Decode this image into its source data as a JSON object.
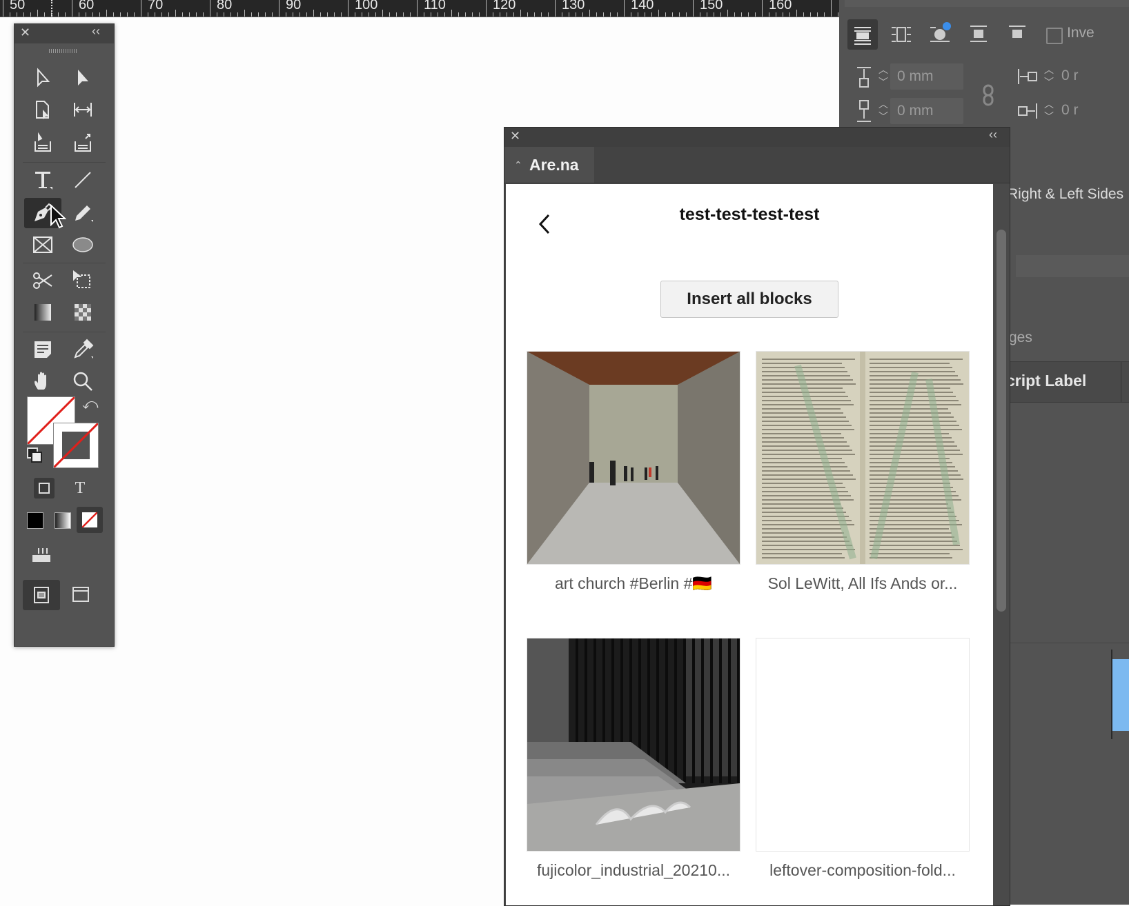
{
  "ruler": {
    "labels": [
      "50",
      "60",
      "70",
      "80",
      "90",
      "100",
      "110",
      "120",
      "130",
      "140",
      "150",
      "160"
    ]
  },
  "right_panel": {
    "invert_label": "Inve",
    "offset_top": "0 mm",
    "offset_bottom": "0 mm",
    "offset_left": "0 r",
    "offset_right": "0 r",
    "wrap_sides": "Right & Left Sides",
    "pages_partial": "ges",
    "script_label_partial": "cript Label"
  },
  "toolbox": {
    "tools": [
      "selection-tool",
      "direct-selection-tool",
      "page-tool",
      "gap-tool",
      "content-collector-tool",
      "content-placer-tool",
      "type-tool",
      "line-tool",
      "pen-tool",
      "pencil-tool",
      "rectangle-frame-tool",
      "ellipse-tool",
      "scissors-tool",
      "free-transform-tool",
      "gradient-swatch-tool",
      "gradient-feather-tool",
      "note-tool",
      "eyedropper-tool",
      "hand-tool",
      "zoom-tool"
    ],
    "active_tool": "pen-tool"
  },
  "arena_panel": {
    "tab_label": "Are.na",
    "channel_title": "test-test-test-test",
    "insert_button": "Insert all blocks",
    "blocks": [
      {
        "caption": "art church #Berlin #🇩🇪",
        "image": "concrete-hall-photo"
      },
      {
        "caption": "Sol LeWitt, All Ifs Ands or...",
        "image": "book-page-scan"
      },
      {
        "caption": "fujicolor_industrial_20210...",
        "image": "stairs-fence-photo"
      },
      {
        "caption": "leftover-composition-fold...",
        "image": "blank"
      }
    ]
  },
  "colors": {
    "panel_bg": "#535353",
    "content_bg": "#ffffff",
    "accent_blue": "#3b8eea"
  }
}
